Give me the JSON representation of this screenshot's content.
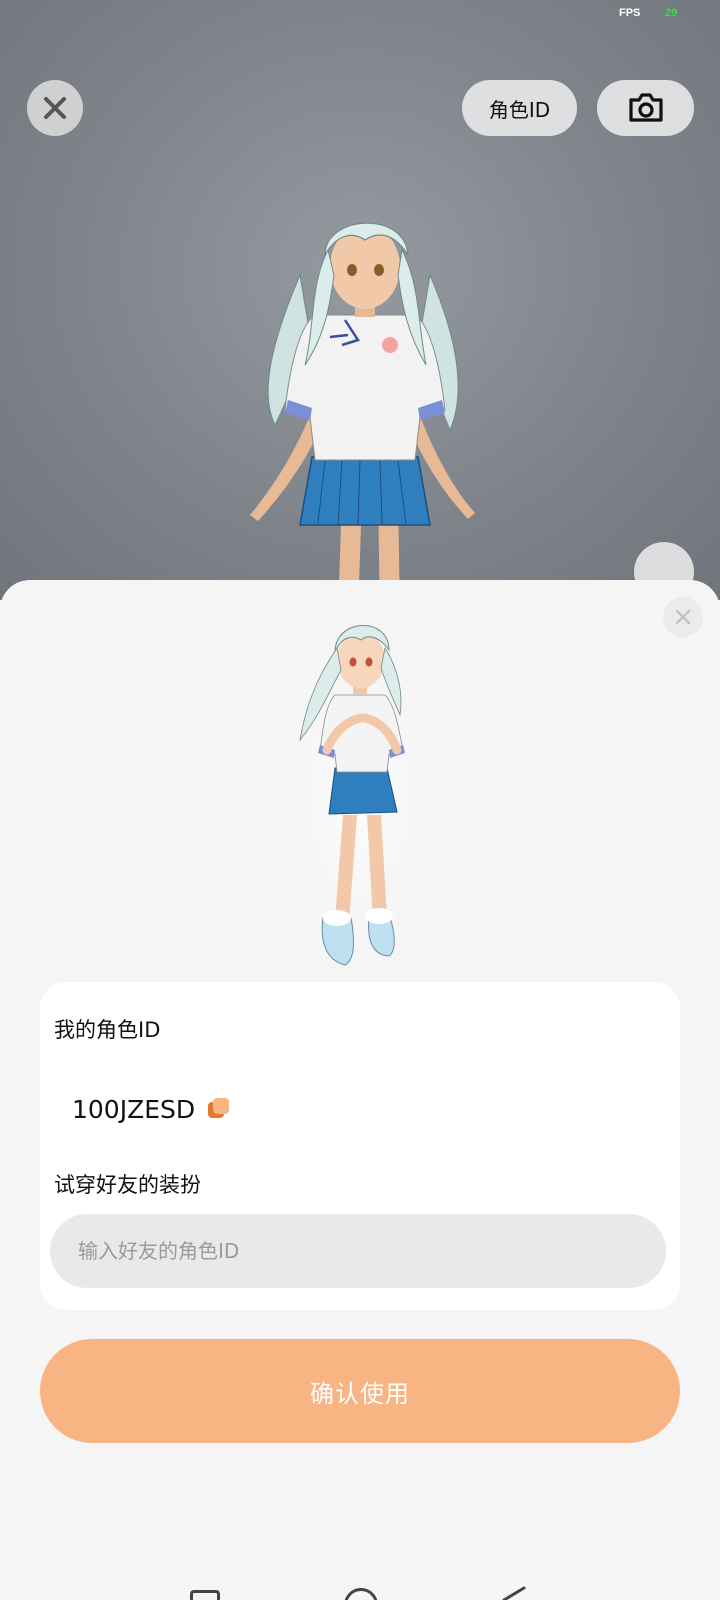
{
  "status": {
    "fps_label": "FPS",
    "fps_value": "29"
  },
  "viewer": {
    "role_id_button": "角色ID",
    "icons": {
      "close": "close-icon",
      "camera": "camera-icon",
      "back": "back-arrow-icon"
    }
  },
  "sheet": {
    "my_id_label": "我的角色ID",
    "my_id_value": "100JZESD",
    "try_label": "试穿好友的装扮",
    "input_placeholder": "输入好友的角色ID",
    "input_value": "",
    "confirm_label": "确认使用",
    "icons": {
      "close": "close-icon",
      "copy": "copy-icon"
    }
  },
  "colors": {
    "accent": "#f8b483",
    "fps_value": "#3ddc4a"
  },
  "navbar": {
    "icons": [
      "recents-icon",
      "home-icon",
      "back-icon"
    ]
  }
}
